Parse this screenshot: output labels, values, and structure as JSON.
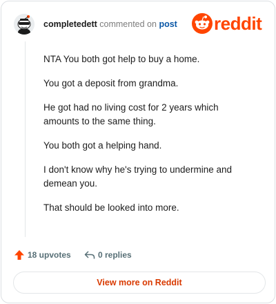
{
  "header": {
    "username": "completedett",
    "action_text": "commented on",
    "post_link": "post",
    "logo_text": "reddit"
  },
  "comment": {
    "paragraphs": [
      "NTA You both got help to buy a home.",
      "You got a deposit from grandma.",
      "He got had no living cost for 2 years which amounts to the same thing.",
      "You both got a helping hand.",
      "I don't know why he's trying to undermine and demean you.",
      "That should be looked into more."
    ]
  },
  "stats": {
    "upvotes": "18 upvotes",
    "replies": "0 replies"
  },
  "footer": {
    "view_more": "View more on Reddit"
  },
  "colors": {
    "brand": "#ff4500",
    "link": "#0a57a6",
    "cta_text": "#d93a00"
  }
}
